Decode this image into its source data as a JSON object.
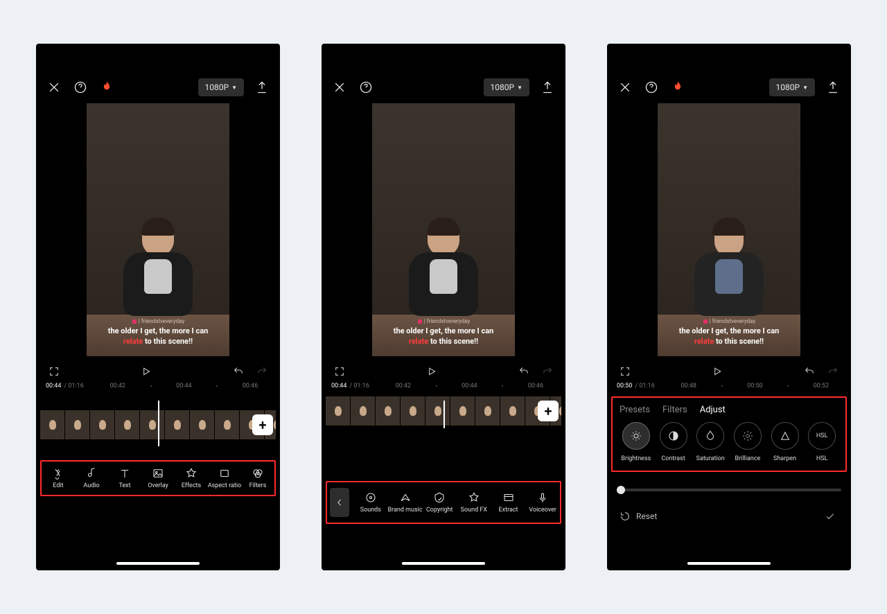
{
  "topbar": {
    "resolution": "1080P"
  },
  "caption": {
    "line1": "the older I get, the more I can",
    "highlight": "relate",
    "line2_rest": " to this scene!!"
  },
  "watermark": {
    "handle": "friendstveveryday"
  },
  "screen1": {
    "time_current": "00:44",
    "time_total": "01:16",
    "ticks": [
      "00:42",
      "00:44",
      "00:46"
    ],
    "tools": [
      {
        "label": "Edit"
      },
      {
        "label": "Audio"
      },
      {
        "label": "Text"
      },
      {
        "label": "Overlay"
      },
      {
        "label": "Effects"
      },
      {
        "label": "Aspect ratio"
      },
      {
        "label": "Filters"
      }
    ]
  },
  "screen2": {
    "time_current": "00:44",
    "time_total": "01:16",
    "ticks": [
      "00:42",
      "00:44",
      "00:46"
    ],
    "tools": [
      {
        "label": "Sounds"
      },
      {
        "label": "Brand music"
      },
      {
        "label": "Copyright"
      },
      {
        "label": "Sound FX"
      },
      {
        "label": "Extract"
      },
      {
        "label": "Voiceover"
      }
    ]
  },
  "screen3": {
    "time_current": "00:50",
    "time_total": "01:16",
    "ticks": [
      "00:48",
      "00:50",
      "00:52"
    ],
    "tabs": [
      "Presets",
      "Filters",
      "Adjust"
    ],
    "active_tab": "Adjust",
    "adjust": [
      {
        "label": "Brightness"
      },
      {
        "label": "Contrast"
      },
      {
        "label": "Saturation"
      },
      {
        "label": "Brilliance"
      },
      {
        "label": "Sharpen"
      },
      {
        "label": "HSL",
        "text_icon": "HSL"
      }
    ],
    "reset_label": "Reset"
  }
}
